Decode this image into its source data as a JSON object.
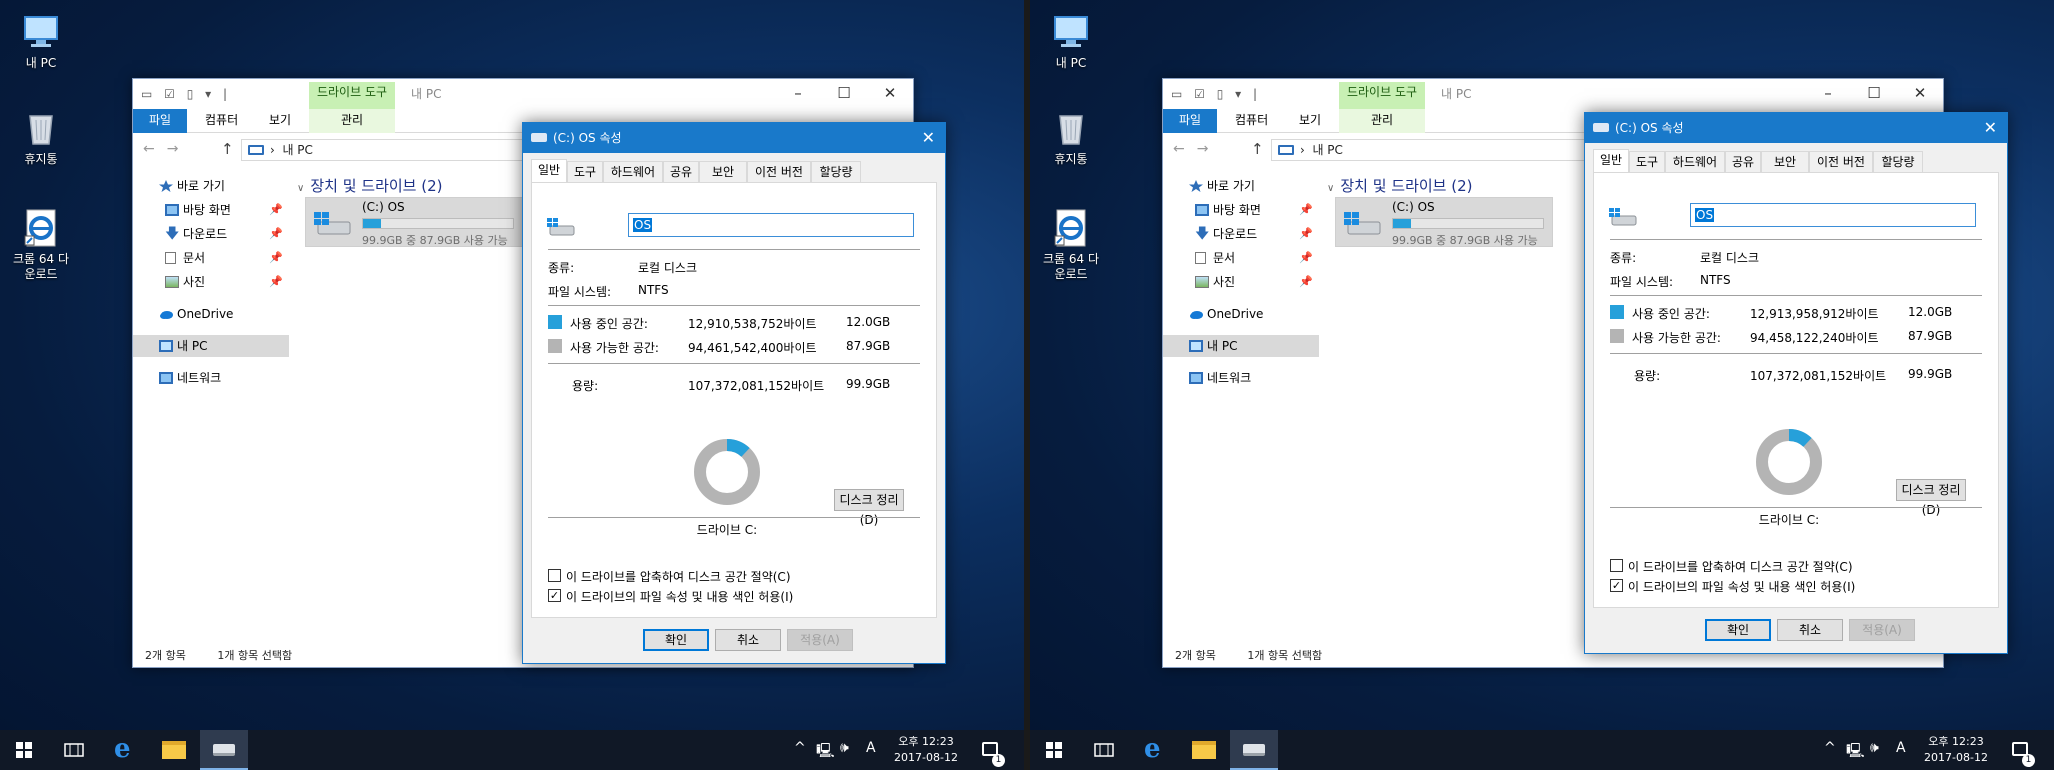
{
  "colors": {
    "accent": "#1979ca",
    "ribbon_context": "#c8f0b4",
    "used_space": "#26a0da",
    "free_space": "#b4b4b4",
    "taskbar": "#101826"
  },
  "desktop": {
    "icons": [
      {
        "label": "내 PC",
        "icon": "computer-icon"
      },
      {
        "label": "휴지통",
        "icon": "recycle-bin-icon"
      },
      {
        "label": "크롬 64 다운로드",
        "icon": "edge-shortcut-icon"
      }
    ]
  },
  "screens": [
    {
      "explorer": {
        "qat_title": "내 PC",
        "context_tab": "드라이브 도구",
        "ribbon_tabs": [
          "파일",
          "컴퓨터",
          "보기",
          "관리"
        ],
        "address": "내 PC",
        "nav": {
          "quick_access": "바로 가기",
          "items": [
            "바탕 화면",
            "다운로드",
            "문서",
            "사진"
          ],
          "onedrive": "OneDrive",
          "this_pc": "내 PC",
          "network": "네트워크"
        },
        "group_title": "장치 및 드라이브 (2)",
        "drive": {
          "name": "(C:) OS",
          "subtitle": "99.9GB 중 87.9GB 사용 가능",
          "used_fraction": 0.12
        },
        "status": {
          "count": "2개 항목",
          "selected": "1개 항목 선택함"
        }
      },
      "props": {
        "title": "(C:) OS 속성",
        "tabs": [
          "일반",
          "도구",
          "하드웨어",
          "공유",
          "보안",
          "이전 버전",
          "할당량"
        ],
        "name_value": "OS",
        "type_label": "종류:",
        "type_value": "로컬 디스크",
        "fs_label": "파일 시스템:",
        "fs_value": "NTFS",
        "used_label": "사용 중인 공간:",
        "used_bytes": "12,910,538,752바이트",
        "used_gb": "12.0GB",
        "free_label": "사용 가능한 공간:",
        "free_bytes": "94,461,542,400바이트",
        "free_gb": "87.9GB",
        "cap_label": "용량:",
        "cap_bytes": "107,372,081,152바이트",
        "cap_gb": "99.9GB",
        "used_fraction": 0.12,
        "drive_label": "드라이브 C:",
        "cleanup": "디스크 정리(D)",
        "compress": "이 드라이브를 압축하여 디스크 공간 절약(C)",
        "compress_checked": false,
        "index": "이 드라이브의 파일 속성 및 내용 색인 허용(I)",
        "index_checked": true,
        "ok": "확인",
        "cancel": "취소",
        "apply": "적용(A)"
      },
      "taskbar": {
        "time": "오후 12:23",
        "date": "2017-08-12",
        "ime": "A",
        "notifications": "1"
      }
    },
    {
      "explorer": {
        "qat_title": "내 PC",
        "context_tab": "드라이브 도구",
        "ribbon_tabs": [
          "파일",
          "컴퓨터",
          "보기",
          "관리"
        ],
        "address": "내 PC",
        "nav": {
          "quick_access": "바로 가기",
          "items": [
            "바탕 화면",
            "다운로드",
            "문서",
            "사진"
          ],
          "onedrive": "OneDrive",
          "this_pc": "내 PC",
          "network": "네트워크"
        },
        "group_title": "장치 및 드라이브 (2)",
        "drive": {
          "name": "(C:) OS",
          "subtitle": "99.9GB 중 87.9GB 사용 가능",
          "used_fraction": 0.12
        },
        "status": {
          "count": "2개 항목",
          "selected": "1개 항목 선택함"
        }
      },
      "props": {
        "title": "(C:) OS 속성",
        "tabs": [
          "일반",
          "도구",
          "하드웨어",
          "공유",
          "보안",
          "이전 버전",
          "할당량"
        ],
        "name_value": "OS",
        "type_label": "종류:",
        "type_value": "로컬 디스크",
        "fs_label": "파일 시스템:",
        "fs_value": "NTFS",
        "used_label": "사용 중인 공간:",
        "used_bytes": "12,913,958,912바이트",
        "used_gb": "12.0GB",
        "free_label": "사용 가능한 공간:",
        "free_bytes": "94,458,122,240바이트",
        "free_gb": "87.9GB",
        "cap_label": "용량:",
        "cap_bytes": "107,372,081,152바이트",
        "cap_gb": "99.9GB",
        "used_fraction": 0.12,
        "drive_label": "드라이브 C:",
        "cleanup": "디스크 정리(D)",
        "compress": "이 드라이브를 압축하여 디스크 공간 절약(C)",
        "compress_checked": false,
        "index": "이 드라이브의 파일 속성 및 내용 색인 허용(I)",
        "index_checked": true,
        "ok": "확인",
        "cancel": "취소",
        "apply": "적용(A)"
      },
      "taskbar": {
        "time": "오후 12:23",
        "date": "2017-08-12",
        "ime": "A",
        "notifications": "1"
      }
    }
  ]
}
